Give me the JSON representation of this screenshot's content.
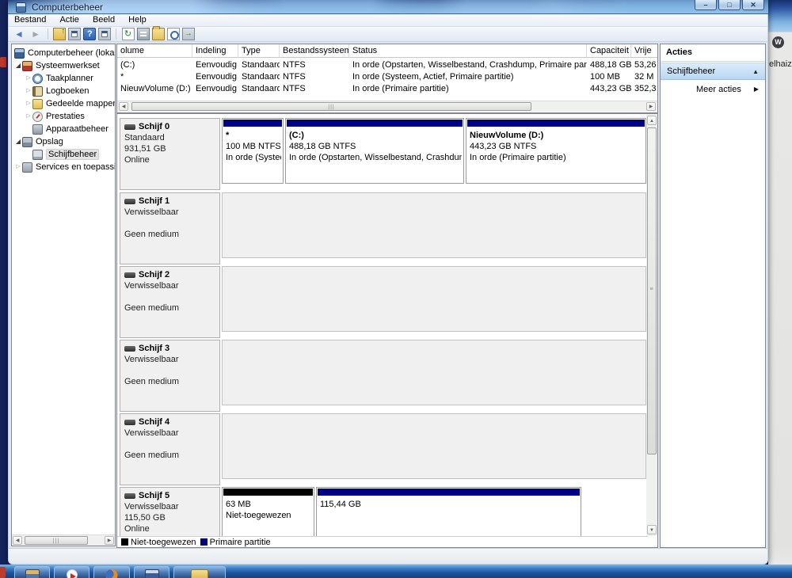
{
  "window": {
    "title": "Computerbeheer"
  },
  "menu": {
    "items": [
      "Bestand",
      "Actie",
      "Beeld",
      "Help"
    ]
  },
  "toolbar": {
    "icons": [
      "back-icon",
      "forward-icon",
      "up-folder-icon",
      "console-window-icon",
      "help-icon",
      "console-window-icon",
      "refresh-icon",
      "properties-icon",
      "open-folder-icon",
      "find-icon",
      "export-list-icon"
    ]
  },
  "tree": {
    "items": [
      {
        "label": "Computerbeheer (lokaal"
      },
      {
        "label": "Systeemwerkset"
      },
      {
        "label": "Taakplanner"
      },
      {
        "label": "Logboeken"
      },
      {
        "label": "Gedeelde mappen"
      },
      {
        "label": "Prestaties"
      },
      {
        "label": "Apparaatbeheer"
      },
      {
        "label": "Opslag"
      },
      {
        "label": "Schijfbeheer"
      },
      {
        "label": "Services en toepassing"
      }
    ]
  },
  "volume_list": {
    "columns": [
      "olume",
      "Indeling",
      "Type",
      "Bestandssysteem",
      "Status",
      "Capaciteit",
      "Vrije"
    ],
    "rows": [
      {
        "volume": "(C:)",
        "indeling": "Eenvoudig",
        "type": "Standaard",
        "fs": "NTFS",
        "status": "In orde (Opstarten, Wisselbestand, Crashdump, Primaire partitie)",
        "capaciteit": "488,18 GB",
        "vrij": "53,26"
      },
      {
        "volume": "*",
        "indeling": "Eenvoudig",
        "type": "Standaard",
        "fs": "NTFS",
        "status": "In orde (Systeem, Actief, Primaire partitie)",
        "capaciteit": "100 MB",
        "vrij": "32 M"
      },
      {
        "volume": "NieuwVolume (D:)",
        "indeling": "Eenvoudig",
        "type": "Standaard",
        "fs": "NTFS",
        "status": "In orde (Primaire partitie)",
        "capaciteit": "443,23 GB",
        "vrij": "352,3"
      }
    ]
  },
  "disks": [
    {
      "name": "Schijf 0",
      "type": "Standaard",
      "size": "931,51 GB",
      "status": "Online",
      "partitions": [
        {
          "label": "*",
          "size": "100 MB NTFS",
          "status": "In orde (Systee",
          "color": "#000082"
        },
        {
          "label": "(C:)",
          "size": "488,18 GB NTFS",
          "status": "In orde (Opstarten, Wisselbestand, Crashdump,",
          "color": "#000082"
        },
        {
          "label": "NieuwVolume  (D:)",
          "size": "443,23 GB NTFS",
          "status": "In orde (Primaire partitie)",
          "color": "#000082"
        }
      ]
    },
    {
      "name": "Schijf 1",
      "type": "Verwisselbaar",
      "media": "Geen medium"
    },
    {
      "name": "Schijf 2",
      "type": "Verwisselbaar",
      "media": "Geen medium"
    },
    {
      "name": "Schijf 3",
      "type": "Verwisselbaar",
      "media": "Geen medium"
    },
    {
      "name": "Schijf 4",
      "type": "Verwisselbaar",
      "media": "Geen medium"
    },
    {
      "name": "Schijf 5",
      "type": "Verwisselbaar",
      "size": "115,50 GB",
      "status": "Online",
      "partitions": [
        {
          "label": "",
          "size": "63 MB",
          "status": "Niet-toegewezen",
          "color": "#000000"
        },
        {
          "label": "",
          "size": "115,44 GB",
          "status": "",
          "color": "#000082"
        }
      ]
    }
  ],
  "legend": {
    "items": [
      {
        "label": "Niet-toegewezen",
        "color": "#000000"
      },
      {
        "label": "Primaire partitie",
        "color": "#000082"
      }
    ]
  },
  "actions": {
    "title": "Acties",
    "group": "Schijfbeheer",
    "more": "Meer acties"
  },
  "desktop": {
    "behind_icon_letter": "W",
    "behind_icon_label": "elhaiz"
  },
  "colors": {
    "primary_partition": "#000082",
    "unallocated": "#000000",
    "selection_blue": "#cde4f7"
  }
}
